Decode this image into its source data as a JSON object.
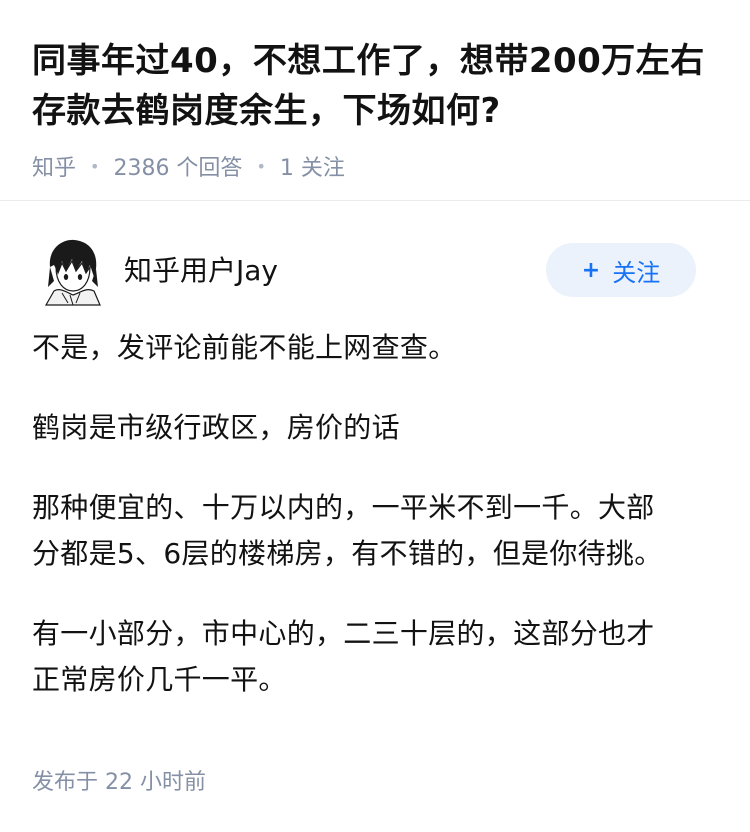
{
  "question": {
    "title_line1": "同事年过40，不想工作了，想带200万左右",
    "title_line2": "存款去鹤岗度余生，下场如何?",
    "source": "知乎",
    "answers": "2386 个回答",
    "follows": "1 关注"
  },
  "answer": {
    "author_name": "知乎用户Jay",
    "avatar_icon": "anime-avatar-icon",
    "follow_label": "关注",
    "paragraphs": {
      "p1": "不是，发评论前能不能上网查查。",
      "p2": "鹤岗是市级行政区，房价的话",
      "p3_line1": "那种便宜的、十万以内的，一平米不到一千。大部",
      "p3_line2": "分都是5、6层的楼梯房，有不错的，但是你待挑。",
      "p4_line1": "有一小部分，市中心的，二三十层的，这部分也才",
      "p4_line2": "正常房价几千一平。"
    },
    "publish_time": "发布于  22 小时前"
  },
  "colors": {
    "meta_gray": "#8590a6",
    "follow_bg": "#ebf2fb",
    "follow_text": "#1772f6",
    "text": "#121212"
  }
}
